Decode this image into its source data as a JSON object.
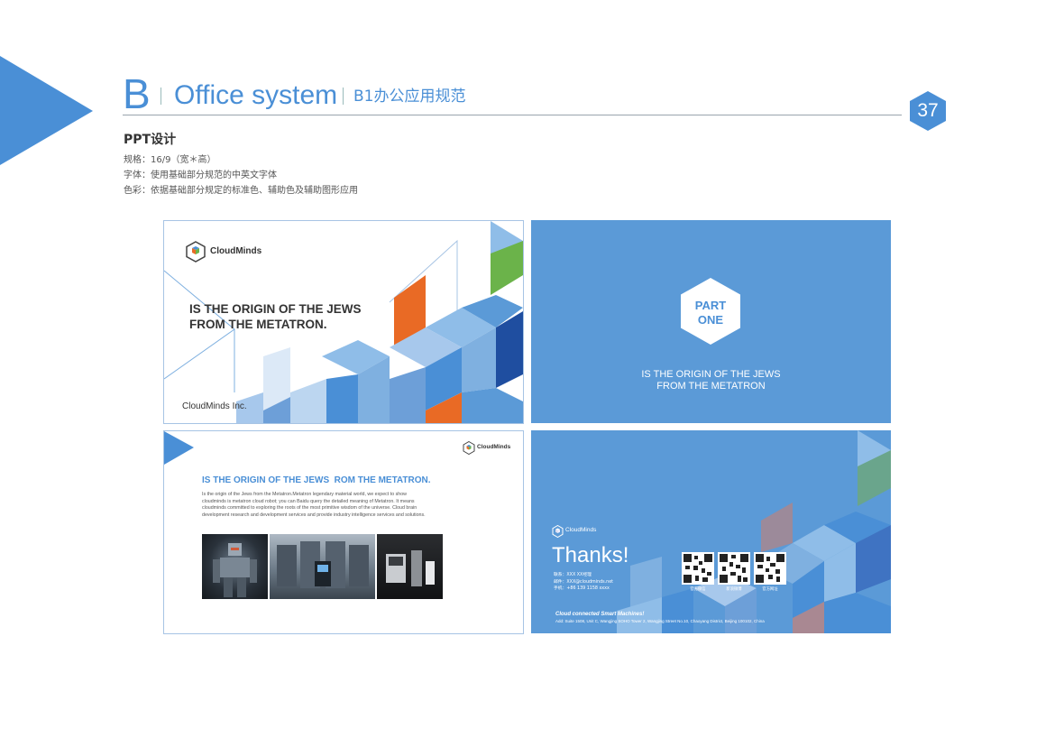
{
  "header": {
    "section_letter": "B",
    "title": "Office system",
    "subtitle": "B1办公应用规范",
    "page_number": "37"
  },
  "section": {
    "title": "PPT设计",
    "spec_lines": [
      "规格：16/9（宽＊高）",
      "字体：使用基础部分规范的中英文字体",
      "色彩：依据基础部分规定的标准色、辅助色及辅助图形应用"
    ]
  },
  "slide1": {
    "logo_text": "CloudMinds",
    "headline": [
      "IS THE ORIGIN OF THE JEWS",
      "FROM THE METATRON."
    ],
    "footer": "CloudMinds Inc."
  },
  "slide2": {
    "badge": [
      "PART",
      "ONE"
    ],
    "caption": [
      "IS THE ORIGIN OF THE JEWS",
      "FROM THE METATRON"
    ]
  },
  "slide3": {
    "logo_text": "CloudMinds",
    "headline": "IS THE ORIGIN OF THE JEWS  ROM THE METATRON.",
    "body": [
      "Is the origin of the Jews from the Metatron.Metatron legendary material world, we expect to show",
      "cloudminds is metatron cloud robot; you can Baidu query the detailed meaning of Metatron. It means",
      "cloudminds committed to exploring the roots of the most primitive wisdom of the universe. Cloud brain",
      "development research and development services and provide industry intelligence services and solutions."
    ]
  },
  "slide4": {
    "logo_text": "CloudMinds",
    "thanks": "Thanks!",
    "contacts": [
      "联系：XXX  XX经理",
      "邮件：XXX@cloudminds.net",
      "手机：+86 139 1158 xxxx"
    ],
    "qr_labels": [
      "官方微信",
      "新浪微博",
      "官方网址"
    ],
    "tagline": "Cloud connected Smart Machines!",
    "address": "Add: Suite 1508, Unit C, Wangjing SOHO Tower 2, Wangjing Street No.10, Chaoyang District, Beijing 100102, China"
  },
  "colors": {
    "brand_blue": "#4a8fd6",
    "slide_blue": "#5b9ad7",
    "accent_orange": "#e96a25",
    "accent_green": "#6bb34a",
    "deep_blue": "#1f4ea0"
  }
}
